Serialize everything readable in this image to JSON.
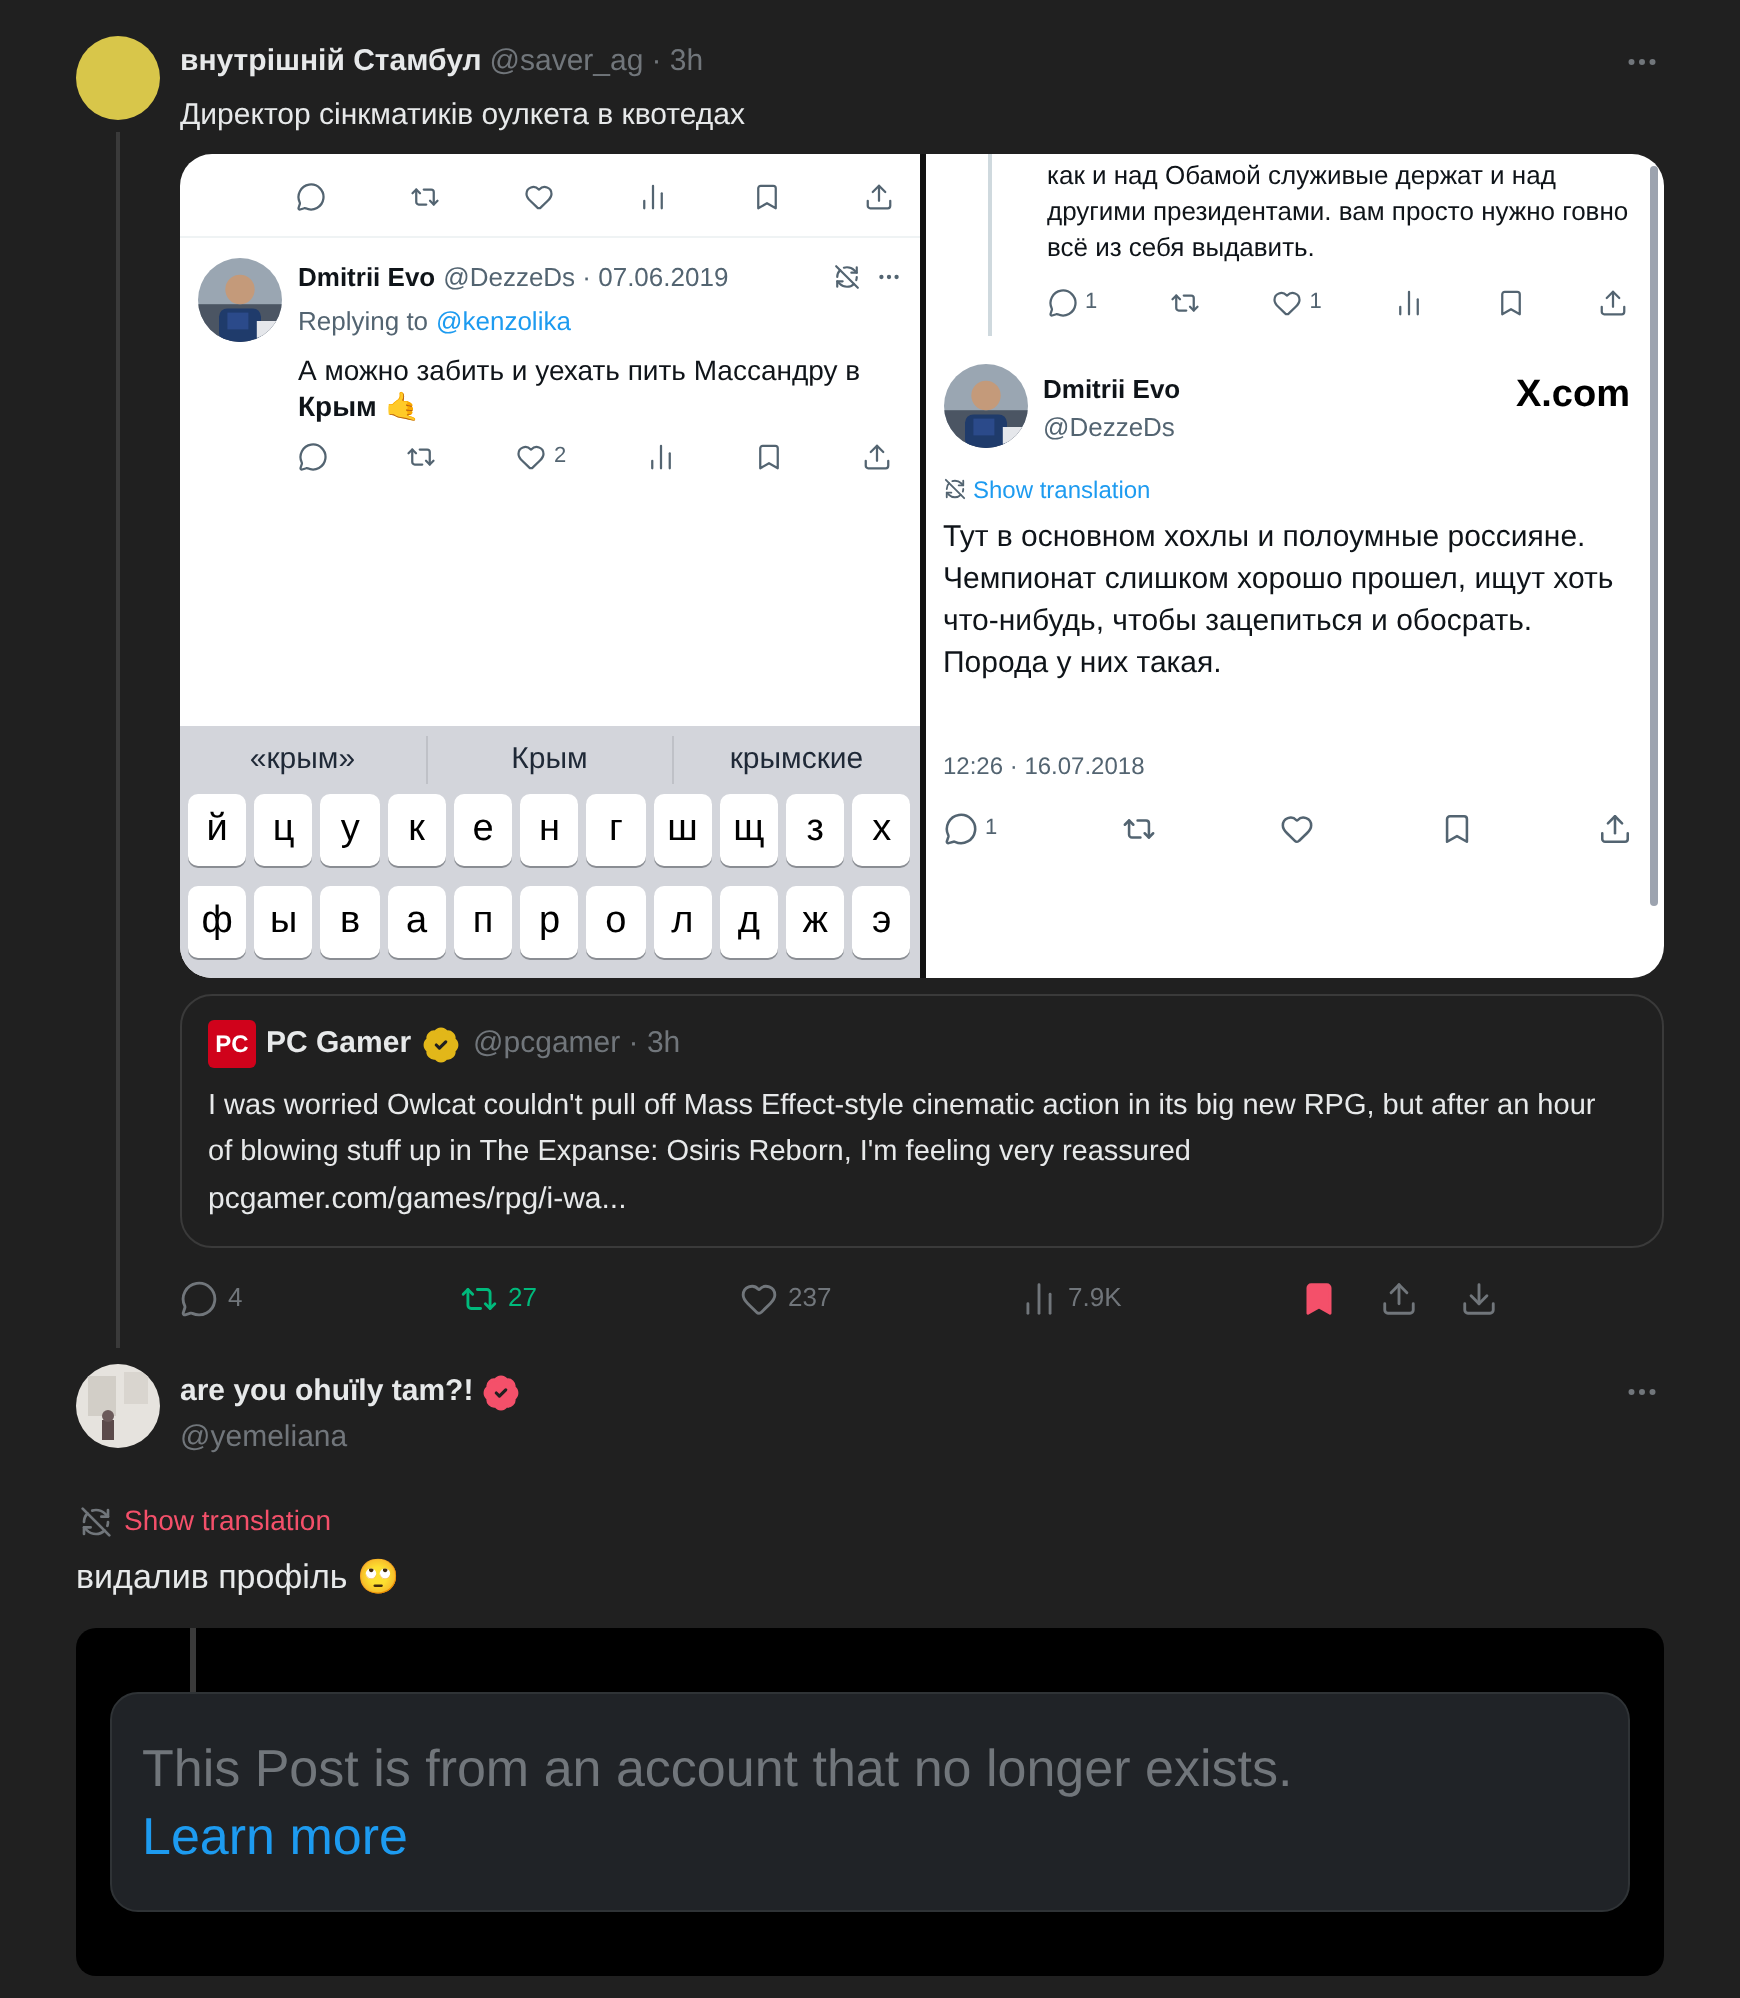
{
  "post": {
    "author": "внутрішній Стамбул",
    "handle": "@saver_ag",
    "time": "· 3h",
    "text": "Директор сінкматиків оулкета в квотедах",
    "images": [
      {
        "kind": "reply_screenshot",
        "reply": {
          "author": "Dmitrii Evo",
          "meta": "@DezzeDs · 07.06.2019",
          "replying_prefix": "Replying to",
          "replying_handle": "@kenzolika",
          "text": "А можно забить и уехать пить Массандру в **Крым** 🤙",
          "like_count": "2"
        },
        "keyboard": {
          "suggestions": [
            "«крым»",
            "Крым",
            "крымские"
          ],
          "rows": [
            [
              "й",
              "ц",
              "у",
              "к",
              "е",
              "н",
              "г",
              "ш",
              "щ",
              "з",
              "х"
            ],
            [
              "ф",
              "ы",
              "в",
              "а",
              "п",
              "р",
              "о",
              "л",
              "д",
              "ж",
              "э"
            ]
          ]
        }
      },
      {
        "kind": "post_screenshot",
        "parent_text": "как и над Обамой служивые держат и над другими президентами. вам просто нужно говно всё из себя выдавить.",
        "parent_reply_count": "1",
        "parent_like_count": "1",
        "author": "Dmitrii Evo",
        "handle": "@DezzeDs",
        "site": "X.com",
        "translate": "Show translation",
        "text": "Тут в основном хохлы и полоумные россияне. Чемпионат слишком хорошо прошел,  ищут хоть что-нибудь, чтобы зацепиться и обосрать. Порода у них такая.",
        "timestamp": "12:26 · 16.07.2018",
        "reply_count": "1"
      }
    ],
    "quote": {
      "logo_text": "PC",
      "author": "PC Gamer",
      "verified": {
        "color": "#e2b719"
      },
      "handle": "@pcgamer · 3h",
      "text": "I was worried Owlcat couldn't pull off Mass Effect-style cinematic action in its big new RPG, but after an hour of blowing stuff up in The Expanse: Osiris Reborn, I'm feeling very reassured",
      "link": "pcgamer.com/games/rpg/i-wa..."
    },
    "actions": [
      {
        "kind": "reply",
        "count": "4",
        "active": false
      },
      {
        "kind": "repost",
        "count": "27",
        "active": true
      },
      {
        "kind": "like",
        "count": "237",
        "active": false
      },
      {
        "kind": "views",
        "count": "7.9K",
        "active": false
      },
      {
        "kind": "bookmark",
        "active": true
      },
      {
        "kind": "share",
        "active": false
      },
      {
        "kind": "download",
        "active": false
      }
    ]
  },
  "reply": {
    "author": "are you ohuïly tam?!",
    "verified": {
      "color": "#f4506a"
    },
    "handle": "@yemeliana",
    "translate": "Show translation",
    "text": "видалив профіль 🙄",
    "embed": {
      "message": "This Post is from an account that no longer exists.",
      "link": "Learn more"
    }
  }
}
